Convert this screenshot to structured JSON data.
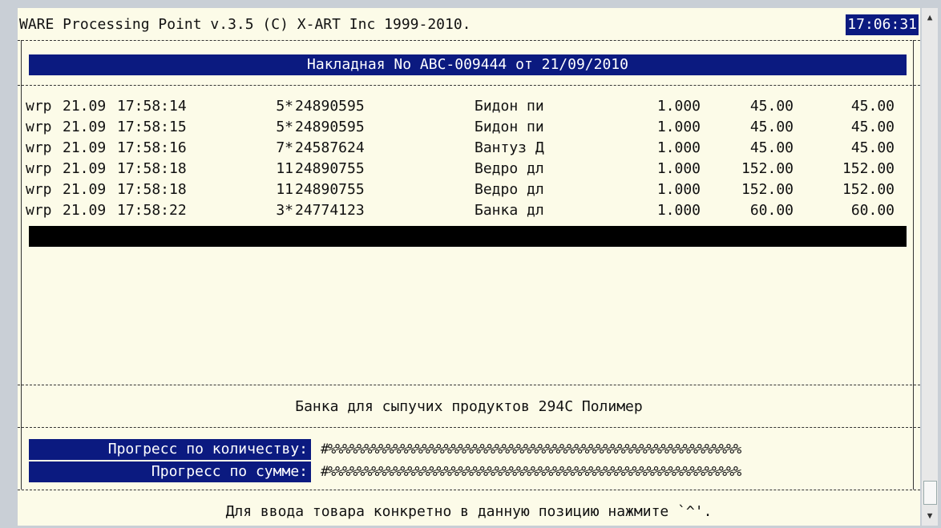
{
  "window": {
    "title_line": "WARE Processing Point v.3.5 (C) X-ART Inc 1999-2010.",
    "clock": "17:06:31"
  },
  "invoice": {
    "heading": "Накладная No ABC-009444 от 21/09/2010"
  },
  "rows": [
    {
      "user": "wrp",
      "date": "21.09",
      "time": "17:58:14",
      "qty_code": "5*",
      "barcode": "24890595",
      "name": "Бидон пи",
      "qty": "1.000",
      "price": "45.00",
      "sum": "45.00"
    },
    {
      "user": "wrp",
      "date": "21.09",
      "time": "17:58:15",
      "qty_code": "5*",
      "barcode": "24890595",
      "name": "Бидон пи",
      "qty": "1.000",
      "price": "45.00",
      "sum": "45.00"
    },
    {
      "user": "wrp",
      "date": "21.09",
      "time": "17:58:16",
      "qty_code": "7*",
      "barcode": "24587624",
      "name": "Вантуз Д",
      "qty": "1.000",
      "price": "45.00",
      "sum": "45.00"
    },
    {
      "user": "wrp",
      "date": "21.09",
      "time": "17:58:18",
      "qty_code": "11",
      "barcode": "24890755",
      "name": "Ведро дл",
      "qty": "1.000",
      "price": "152.00",
      "sum": "152.00"
    },
    {
      "user": "wrp",
      "date": "21.09",
      "time": "17:58:18",
      "qty_code": "11",
      "barcode": "24890755",
      "name": "Ведро дл",
      "qty": "1.000",
      "price": "152.00",
      "sum": "152.00"
    },
    {
      "user": "wrp",
      "date": "21.09",
      "time": "17:58:22",
      "qty_code": "3*",
      "barcode": "24774123",
      "name": "Банка дл",
      "qty": "1.000",
      "price": "60.00",
      "sum": "60.00"
    }
  ],
  "selected_item_description": "Банка для сыпучих продуктов 294С Полимер",
  "progress": {
    "quantity_label": "Прогресс по количеству:",
    "sum_label": "Прогресс по сумме:",
    "quantity_bar": "#%%%%%%%%%%%%%%%%%%%%%%%%%%%%%%%%%%%%%%%%%%%%%%%%%%%%%%%%%",
    "sum_bar": "#%%%%%%%%%%%%%%%%%%%%%%%%%%%%%%%%%%%%%%%%%%%%%%%%%%%%%%%%%"
  },
  "hint": "Для ввода товара конкретно в данную позицию нажмите `^'.",
  "colors": {
    "terminal_bg": "#fcfbe8",
    "highlight_blue": "#0b1a80",
    "cursor_black": "#000000"
  },
  "icons": {
    "scroll_up": "scroll-up-arrow-icon",
    "scroll_down": "scroll-down-arrow-icon"
  }
}
